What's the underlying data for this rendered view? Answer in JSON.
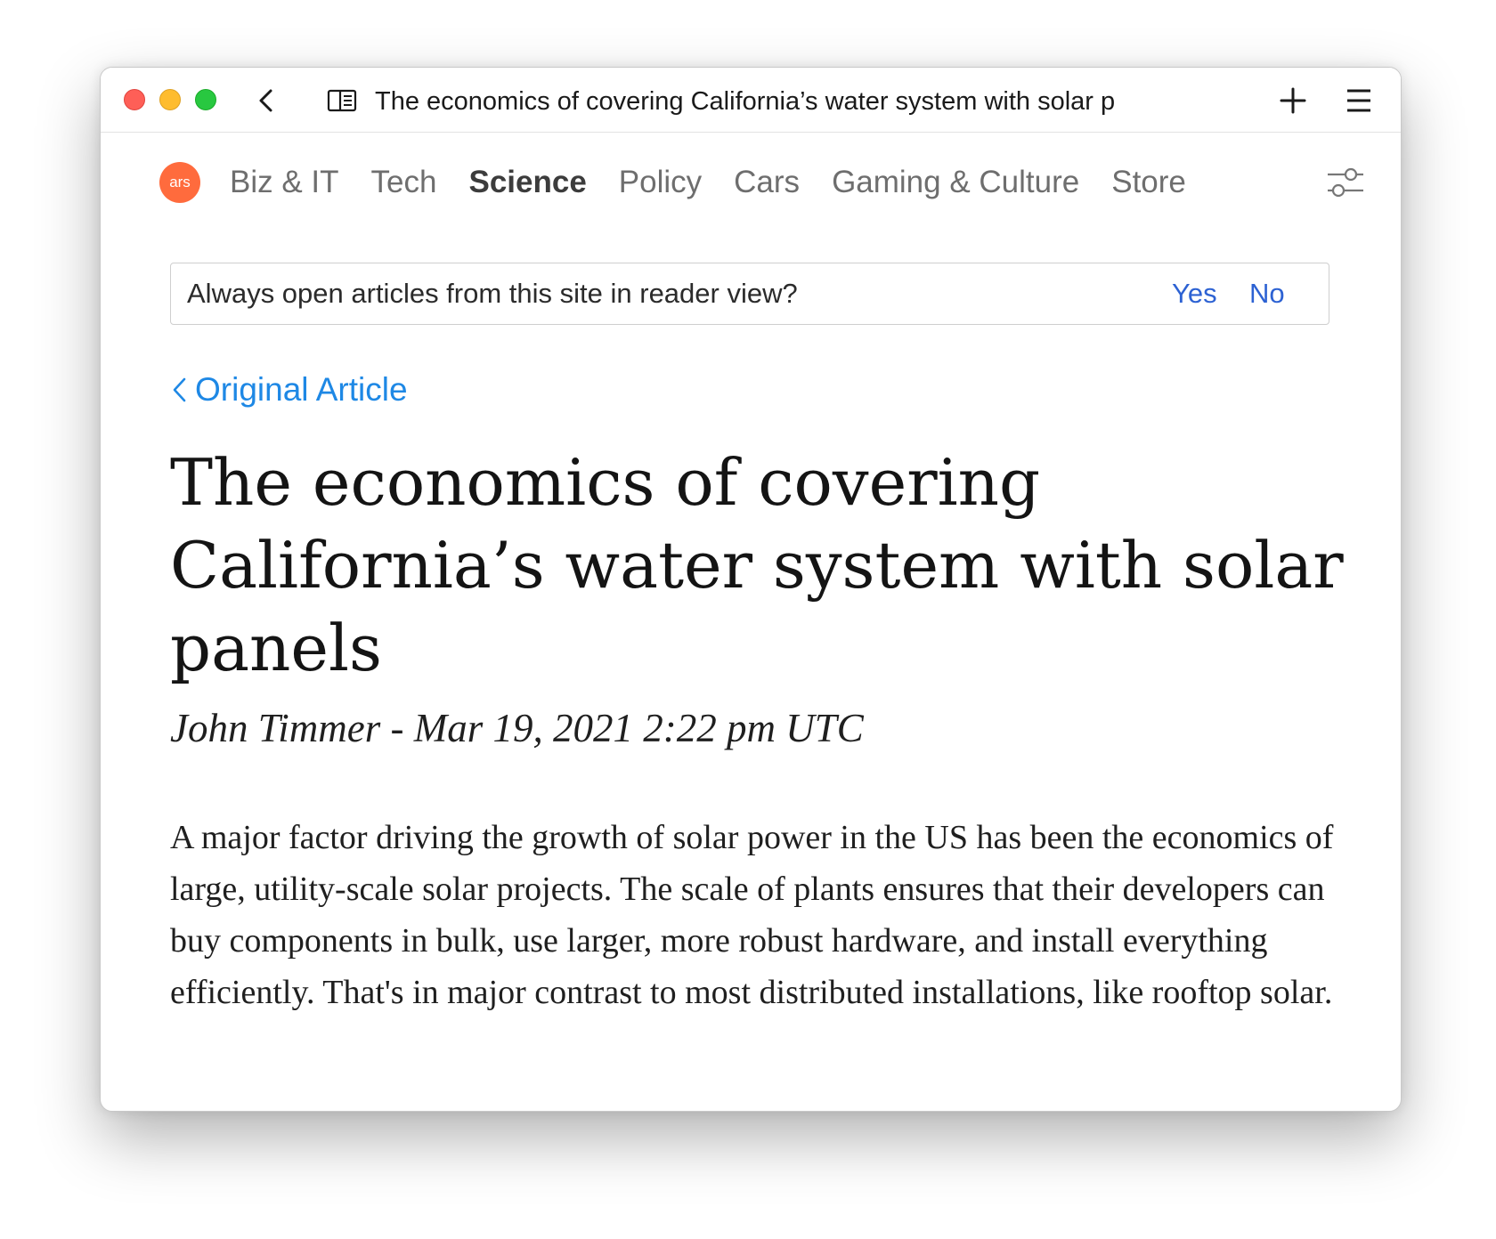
{
  "window": {
    "tab_title": "The economics of covering California’s water system with solar p"
  },
  "toolbar": {
    "back_icon": "chevron-left-icon",
    "reader_icon": "reader-view-icon",
    "new_tab_icon": "plus-icon",
    "menu_icon": "hamburger-menu-icon"
  },
  "site_nav": {
    "logo_text": "ars",
    "logo_color": "#ff6b3d",
    "items": [
      {
        "label": "Biz & IT",
        "active": false
      },
      {
        "label": "Tech",
        "active": false
      },
      {
        "label": "Science",
        "active": true
      },
      {
        "label": "Policy",
        "active": false
      },
      {
        "label": "Cars",
        "active": false
      },
      {
        "label": "Gaming & Culture",
        "active": false
      },
      {
        "label": "Store",
        "active": false
      }
    ],
    "settings_icon": "sliders-icon"
  },
  "reader_banner": {
    "question": "Always open articles from this site in reader view?",
    "yes_label": "Yes",
    "no_label": "No",
    "accent": "#2d62d3"
  },
  "article": {
    "back_link_label": "Original Article",
    "back_link_color": "#1e88e5",
    "title": "The economics of covering California’s water system with solar panels",
    "byline": "John Timmer - Mar 19, 2021 2:22 pm UTC",
    "body": "A major factor driving the growth of solar power in the US has been the economics of large, utility-scale solar projects. The scale of plants ensures that their developers can buy components in bulk, use larger, more robust hardware, and install everything efficiently. That's in major contrast to most distributed installations, like rooftop solar."
  }
}
